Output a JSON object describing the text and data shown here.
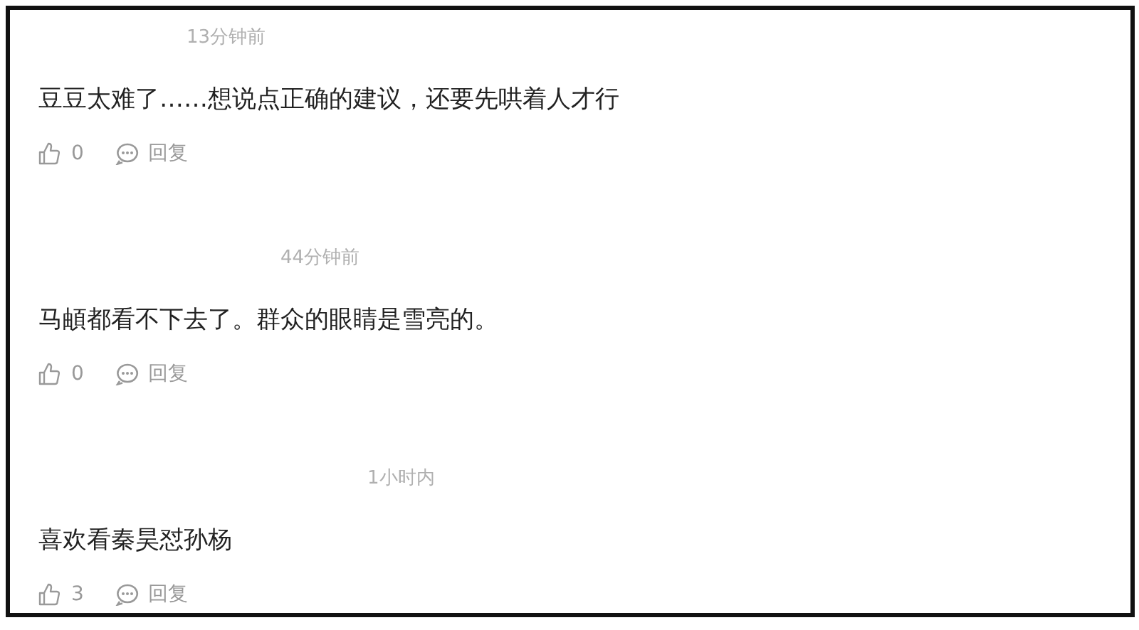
{
  "comments": [
    {
      "time": "13分钟前",
      "text": "豆豆太难了……想说点正确的建议，还要先哄着人才行",
      "likes": "0",
      "reply": "回复"
    },
    {
      "time": "44分钟前",
      "text": "马頔都看不下去了。群众的眼睛是雪亮的。",
      "likes": "0",
      "reply": "回复"
    },
    {
      "time": "1小时内",
      "text": "喜欢看秦昊怼孙杨",
      "likes": "3",
      "reply": "回复"
    }
  ]
}
